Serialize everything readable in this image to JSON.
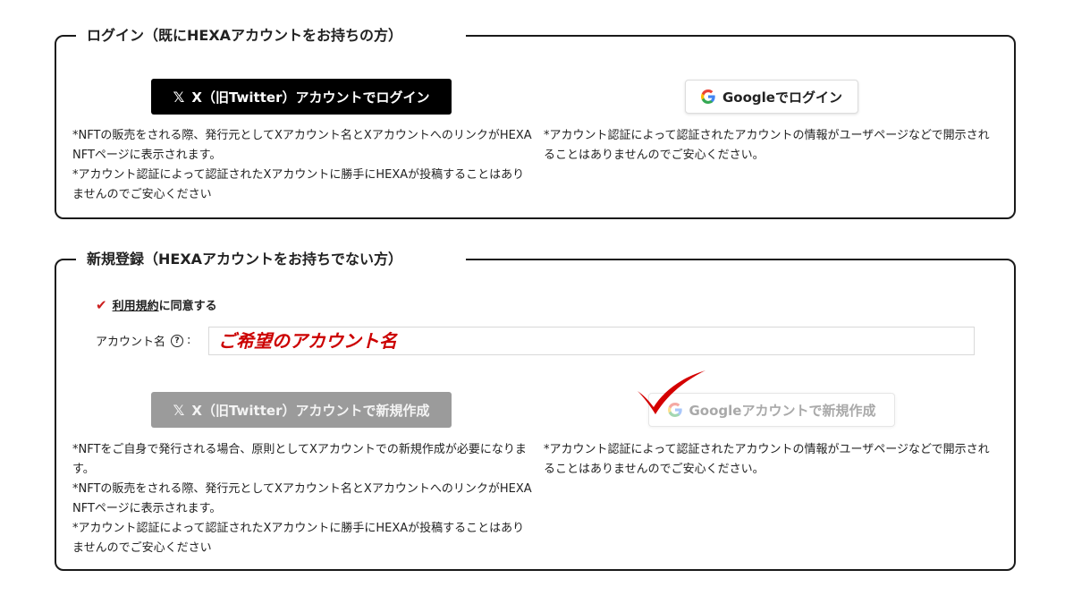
{
  "login": {
    "title": "ログイン（既にHEXAアカウントをお持ちの方）",
    "x_button": {
      "logo": "𝕏",
      "label": "X（旧Twitter）アカウントでログイン"
    },
    "google_button": {
      "label": "Googleでログイン"
    },
    "x_notes": "*NFTの販売をされる際、発行元としてXアカウント名とXアカウントへのリンクがHEXA NFTページに表示されます。\n*アカウント認証によって認証されたXアカウントに勝手にHEXAが投稿することはありませんのでご安心ください",
    "google_notes": "*アカウント認証によって認証されたアカウントの情報がユーザページなどで開示されることはありませんのでご安心ください。"
  },
  "signup": {
    "title": "新規登録（HEXAアカウントをお持ちでない方）",
    "agree": {
      "link": "利用規約",
      "suffix": "に同意する",
      "checked": true
    },
    "account_name": {
      "label": "アカウント名",
      "help_icon": "?",
      "colon": ":",
      "placeholder": "ご希望のアカウント名",
      "value": ""
    },
    "x_button": {
      "logo": "𝕏",
      "label": "X（旧Twitter）アカウントで新規作成",
      "enabled": false
    },
    "google_button": {
      "label": "Googleアカウントで新規作成",
      "enabled": false
    },
    "x_notes": "*NFTをご自身で発行される場合、原則としてXアカウントでの新規作成が必要になります。\n*NFTの販売をされる際、発行元としてXアカウント名とXアカウントへのリンクがHEXA NFTページに表示されます。\n*アカウント認証によって認証されたXアカウントに勝手にHEXAが投稿することはありませんのでご安心ください",
    "google_notes": "*アカウント認証によって認証されたアカウントの情報がユーザページなどで開示されることはありませんのでご安心ください。"
  },
  "colors": {
    "border": "#1a1a1a",
    "x_button": "#000000",
    "x_button_disabled": "#9b9b9b",
    "accent_red": "#cc0000",
    "google_blue": "#4285F4",
    "google_red": "#EA4335",
    "google_yellow": "#FBBC05",
    "google_green": "#34A853"
  },
  "icons": [
    "x-logo-icon",
    "google-logo-icon",
    "checkmark-icon",
    "help-circle-icon",
    "red-checkmark-annotation-icon"
  ]
}
